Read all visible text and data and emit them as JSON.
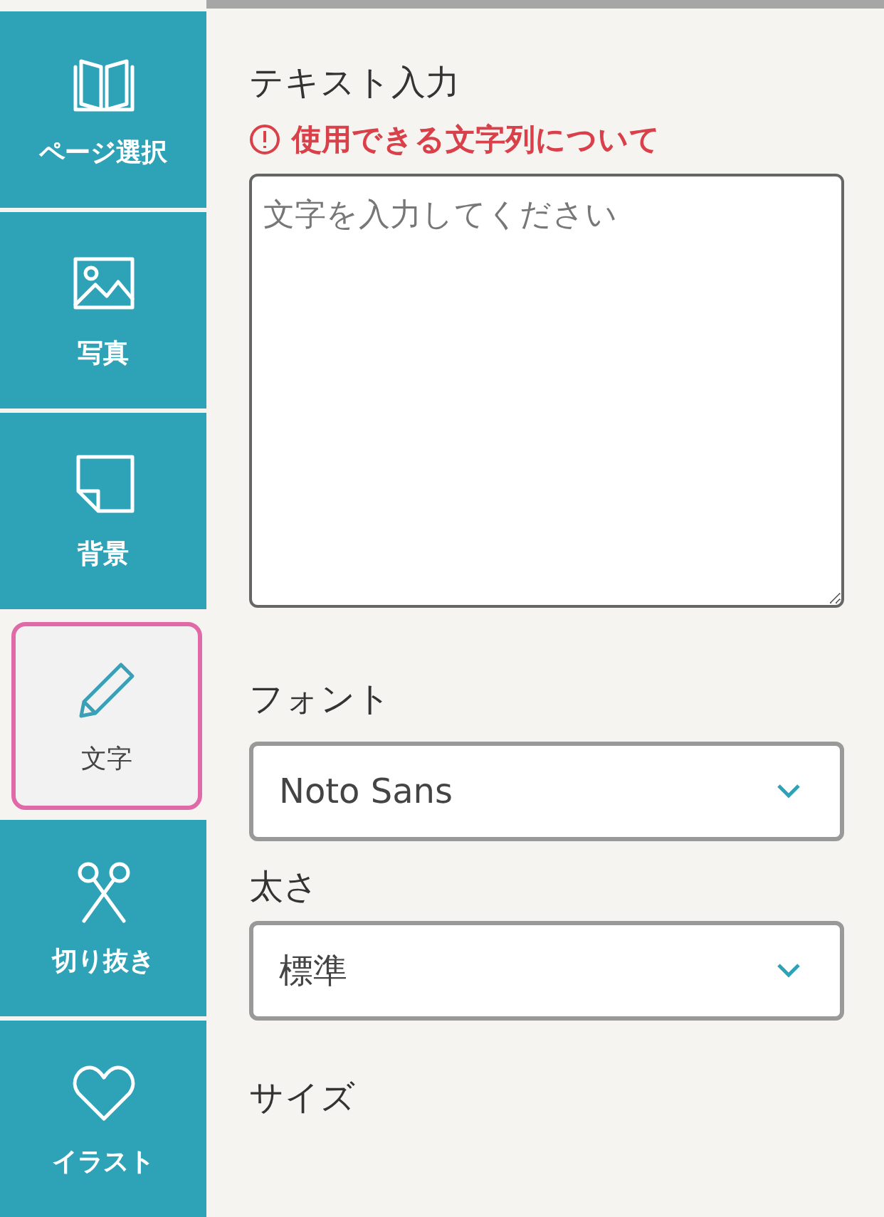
{
  "sidebar": {
    "items": [
      {
        "kind": "book",
        "label": "ページ選択",
        "selected": false
      },
      {
        "kind": "photo",
        "label": "写真",
        "selected": false
      },
      {
        "kind": "note",
        "label": "背景",
        "selected": false
      },
      {
        "kind": "pencil",
        "label": "文字",
        "selected": true
      },
      {
        "kind": "scissors",
        "label": "切り抜き",
        "selected": false
      },
      {
        "kind": "heart",
        "label": "イラスト",
        "selected": false
      }
    ]
  },
  "panel": {
    "title": "テキスト入力",
    "notice": "使用できる文字列について",
    "text_input": {
      "placeholder": "文字を入力してください"
    },
    "font": {
      "label": "フォント",
      "value": "Noto Sans"
    },
    "weight": {
      "label": "太さ",
      "value": "標準"
    },
    "size": {
      "label": "サイズ"
    }
  }
}
